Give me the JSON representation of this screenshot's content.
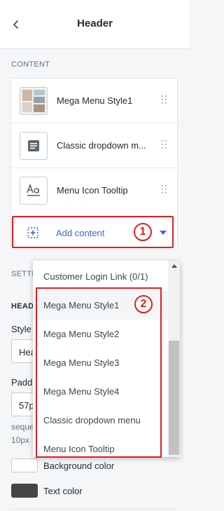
{
  "header": {
    "title": "Header"
  },
  "sections": {
    "content_label": "CONTENT",
    "settings_label_partial": "SETTI",
    "header_label_partial": "HEAD"
  },
  "blocks": [
    {
      "label": "Mega Menu Style1",
      "icon": "image-thumbnail-icon"
    },
    {
      "label": "Classic dropdown m...",
      "icon": "document-icon"
    },
    {
      "label": "Menu Icon Tooltip",
      "icon": "text-font-icon"
    }
  ],
  "add_content": {
    "label": "Add content"
  },
  "annotations": {
    "badge_1": "1",
    "badge_2": "2"
  },
  "settings_partial": {
    "style_label": "Style",
    "style_value": "Hea",
    "padding_label": "Padd",
    "padding_value": "57p",
    "hint_line1": "seque",
    "hint_line2": "10px"
  },
  "colors": [
    {
      "label": "Background color",
      "swatch": "#ffffff"
    },
    {
      "label": "Text color",
      "swatch": "#454545"
    }
  ],
  "dropdown": {
    "items": [
      "Customer Login Link (0/1)",
      "Mega Menu Style1",
      "Mega Menu Style2",
      "Mega Menu Style3",
      "Mega Menu Style4",
      "Classic dropdown menu",
      "Menu Icon Tooltip"
    ]
  },
  "accent_colors": {
    "link": "#3f67c7",
    "annotation": "#e02020"
  }
}
